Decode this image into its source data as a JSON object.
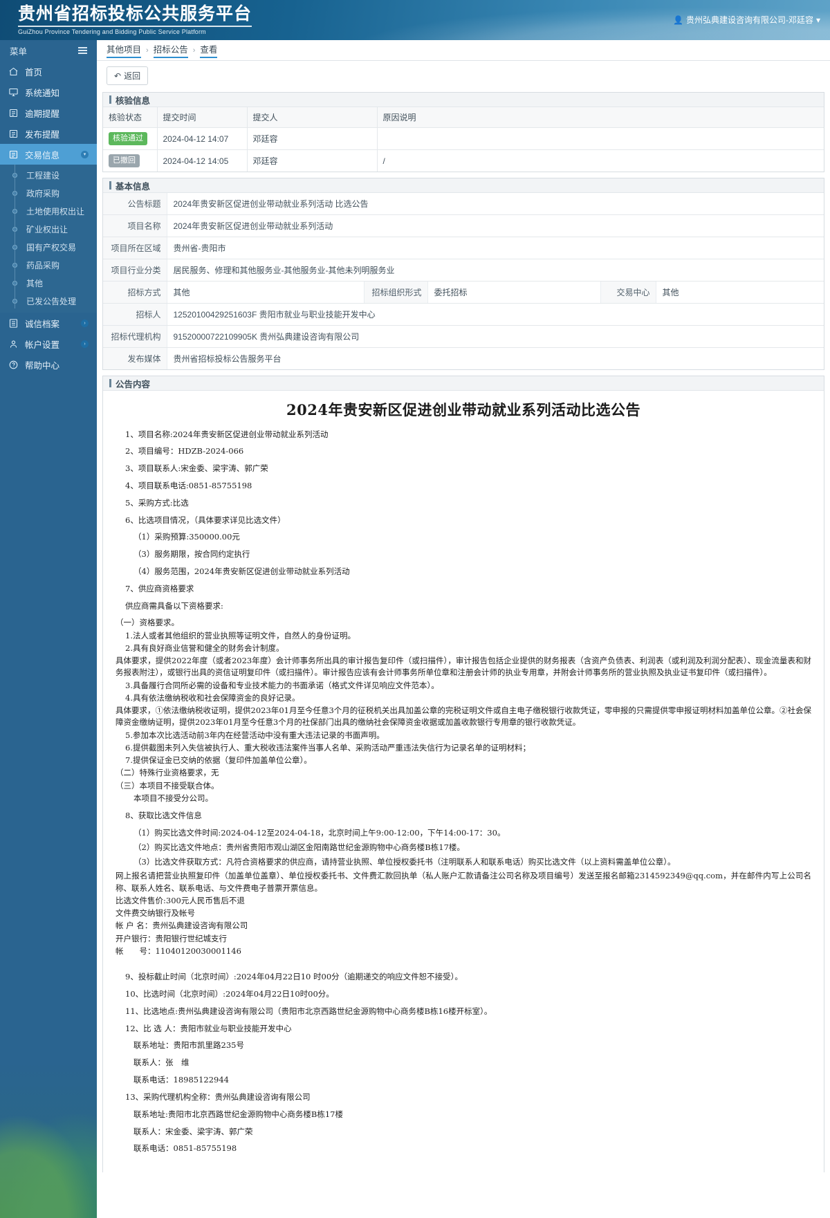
{
  "header": {
    "brand_cn": "贵州省招标投标公共服务平台",
    "brand_en": "GuiZhou Province Tendering and Bidding Public Service Platform",
    "user": "贵州弘典建设咨询有限公司-邓廷容"
  },
  "sidebar": {
    "menu_label": "菜单",
    "items": [
      {
        "label": "首页",
        "icon": "home-icon",
        "active": false
      },
      {
        "label": "系统通知",
        "icon": "monitor-icon",
        "active": false
      },
      {
        "label": "逾期提醒",
        "icon": "document-icon",
        "active": false
      },
      {
        "label": "发布提醒",
        "icon": "document-icon",
        "active": false
      },
      {
        "label": "交易信息",
        "icon": "document-icon",
        "active": true,
        "caret": "▾"
      },
      {
        "label": "诚信档案",
        "icon": "list-icon",
        "active": false,
        "caret": "›"
      },
      {
        "label": "帐户设置",
        "icon": "user-icon",
        "active": false,
        "caret": "›"
      },
      {
        "label": "帮助中心",
        "icon": "question-icon",
        "active": false
      }
    ],
    "sub_items": [
      {
        "label": "工程建设"
      },
      {
        "label": "政府采购"
      },
      {
        "label": "土地使用权出让"
      },
      {
        "label": "矿业权出让"
      },
      {
        "label": "国有产权交易"
      },
      {
        "label": "药品采购"
      },
      {
        "label": "其他"
      },
      {
        "label": "已发公告处理"
      }
    ]
  },
  "breadcrumb": {
    "items": [
      "其他项目",
      "招标公告",
      "查看"
    ],
    "separator": "›"
  },
  "toolbar": {
    "back_label": "返回",
    "back_icon": "undo-icon"
  },
  "verify_panel": {
    "title": "核验信息",
    "columns": [
      "核验状态",
      "提交时间",
      "提交人",
      "原因说明"
    ],
    "rows": [
      {
        "status": "核验通过",
        "status_type": "pass",
        "time": "2024-04-12 14:07",
        "person": "邓廷容",
        "reason": ""
      },
      {
        "status": "已撤回",
        "status_type": "revoked",
        "time": "2024-04-12 14:05",
        "person": "邓廷容",
        "reason": "/"
      }
    ]
  },
  "basic_panel": {
    "title": "基本信息",
    "fields": {
      "notice_title_label": "公告标题",
      "notice_title_value": "2024年贵安新区促进创业带动就业系列活动 比选公告",
      "project_name_label": "项目名称",
      "project_name_value": "2024年贵安新区促进创业带动就业系列活动",
      "region_label": "项目所在区域",
      "region_value": "贵州省-贵阳市",
      "industry_label": "项目行业分类",
      "industry_value": "居民服务、修理和其他服务业-其他服务业-其他未列明服务业",
      "bid_method_label": "招标方式",
      "bid_method_value": "其他",
      "org_form_label": "招标组织形式",
      "org_form_value": "委托招标",
      "center_label": "交易中心",
      "center_value": "其他",
      "tenderer_label": "招标人",
      "tenderer_value": "12520100429251603F 贵阳市就业与职业技能开发中心",
      "agency_label": "招标代理机构",
      "agency_value": "91520000722109905K 贵州弘典建设咨询有限公司",
      "media_label": "发布媒体",
      "media_value": "贵州省招标投标公告服务平台"
    }
  },
  "content_panel": {
    "title": "公告内容",
    "doc_title": "2024年贵安新区促进创业带动就业系列活动比选公告",
    "lines": [
      "1、项目名称:2024年贵安新区促进创业带动就业系列活动",
      "2、项目编号：HDZB-2024-066",
      "3、项目联系人:宋金委、梁宇涛、郭广荣",
      "4、项目联系电话:0851-85755198",
      "5、采购方式:比选",
      "6、比选项目情况，（具体要求详见比选文件）"
    ],
    "sub_lines": [
      "（1）采购预算:350000.00元",
      "（3）服务期限，按合同约定执行",
      "（4）服务范围，2024年贵安新区促进创业带动就业系列活动"
    ],
    "lines2": [
      "7、供应商资格要求",
      "供应商需具备以下资格要求:"
    ],
    "qual_heading": "（一）资格要求。",
    "qual_items": [
      "1.法人或者其他组织的营业执照等证明文件，自然人的身份证明。",
      "2.具有良好商业信誉和健全的财务会计制度。"
    ],
    "detail_1": "具体要求，提供2022年度（或者2023年度）会计师事务所出具的审计报告复印件（或扫描件），审计报告包括企业提供的财务报表（含资产负债表、利润表（或利润及利润分配表）、现金流量表和财务报表附注），或银行出具的资信证明复印件（或扫描件）。审计报告应该有会计师事务所单位章和注册会计师的执业专用章，并附会计师事务所的营业执照及执业证书复印件（或扫描件）。",
    "qual_items2": [
      "3.具备履行合同所必需的设备和专业技术能力的书面承诺（格式文件详见响应文件范本）。",
      "4.具有依法缴纳税收和社会保障资金的良好记录。"
    ],
    "detail_2": "具体要求，①依法缴纳税收证明，提供2023年01月至今任意3个月的征税机关出具加盖公章的完税证明文件或自主电子缴税银行收款凭证，零申报的只需提供零申报证明材料加盖单位公章。②社会保障资金缴纳证明，提供2023年01月至今任意3个月的社保部门出具的缴纳社会保障资金收据或加盖收款银行专用章的银行收款凭证。",
    "qual_items3": [
      "5.参加本次比选活动前3年内在经营活动中没有重大违法记录的书面声明。",
      "6.提供截图未列入失信被执行人、重大税收违法案件当事人名单、采购活动严重违法失信行为记录名单的证明材料；",
      "7.提供保证金已交纳的依据（复印件加盖单位公章）。"
    ],
    "clause_2": "（二）特殊行业资格要求，无",
    "clause_3": "（三）本项目不接受联合体。",
    "clause_3b": "本项目不接受分公司。",
    "item8": "8、获取比选文件信息",
    "item8_subs": [
      "（1）购买比选文件时间:2024-04-12至2024-04-18，北京时间上午9:00-12:00，下午14:00-17：30。",
      "（2）购买比选文件地点：贵州省贵阳市观山湖区金阳南路世纪金源购物中心商务楼B栋17楼。",
      "（3）比选文件获取方式：凡符合资格要求的供应商，请持营业执照、单位授权委托书（注明联系人和联系电话）购买比选文件（以上资料需盖单位公章）。"
    ],
    "mail_para": "网上报名请把营业执照复印件（加盖单位盖章）、单位授权委托书、文件费汇款回执单（私人账户汇款请备注公司名称及项目编号）发送至报名邮箱2314592349@qq.com，并在邮件内写上公司名称、联系人姓名、联系电话、与文件费电子普票开票信息。",
    "price_lines": [
      "比选文件售价:300元人民币售后不退",
      "文件费交纳银行及帐号",
      "帐 户 名：贵州弘典建设咨询有限公司",
      "开户银行：贵阳银行世纪城支行",
      "帐　　号：11040120030001146"
    ],
    "tail_lines": [
      "9、投标截止时间（北京时间）:2024年04月22日10 时00分（逾期递交的响应文件恕不接受）。",
      "10、比选时间（北京时间）:2024年04月22日10时00分。",
      "11、比选地点:贵州弘典建设咨询有限公司（贵阳市北京西路世纪金源购物中心商务楼B栋16楼开标室）。",
      "12、比 选 人：贵阳市就业与职业技能开发中心"
    ],
    "contact1": [
      "联系地址：贵阳市凯里路235号",
      "联系人：张　维",
      "联系电话：18985122944"
    ],
    "tail_lines2": [
      "13、采购代理机构全称：贵州弘典建设咨询有限公司"
    ],
    "contact2": [
      "联系地址:贵阳市北京西路世纪金源购物中心商务楼B栋17楼",
      "联系人：宋金委、梁宇涛、郭广荣",
      "联系电话：0851-85755198"
    ]
  }
}
